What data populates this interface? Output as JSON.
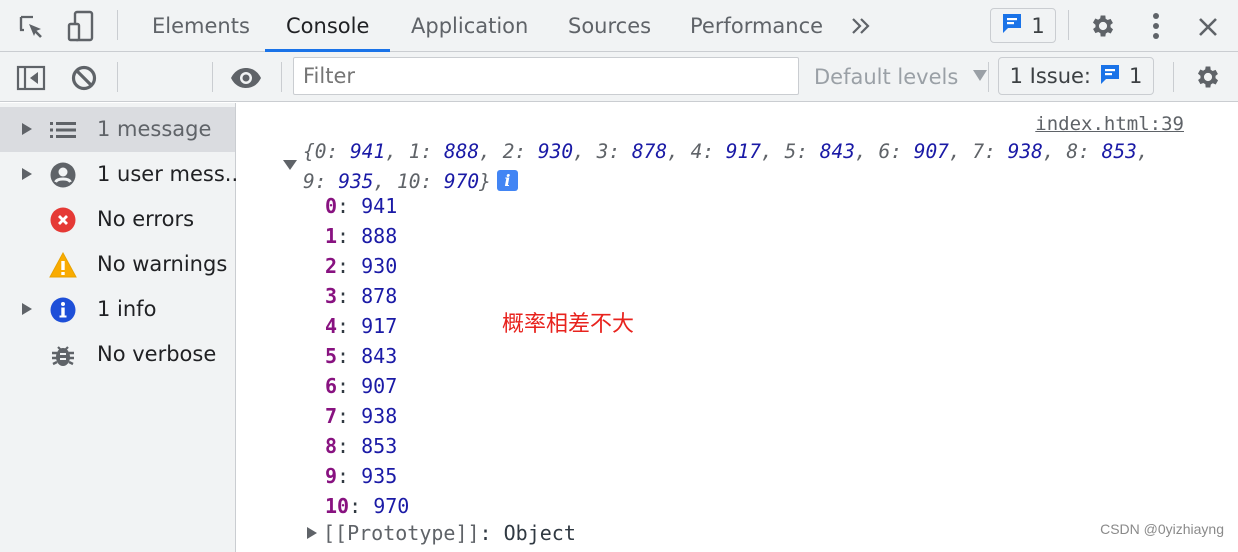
{
  "tabs": [
    {
      "label": "Elements",
      "active": false
    },
    {
      "label": "Console",
      "active": true
    },
    {
      "label": "Application",
      "active": false
    },
    {
      "label": "Sources",
      "active": false
    },
    {
      "label": "Performance",
      "active": false
    }
  ],
  "tabbar": {
    "more_tabs_icon": "chevrons-right-icon",
    "messages_count": "1",
    "accent": "#1a73e8"
  },
  "toolbar": {
    "context": "top",
    "filter_placeholder": "Filter",
    "filter_value": "",
    "levels": "Default levels",
    "issues_label": "1 Issue:",
    "issues_count": "1"
  },
  "sidebar": {
    "items": [
      {
        "label": "1 message",
        "icon": "list-icon",
        "expandable": true,
        "selected": true
      },
      {
        "label": "1 user mess...",
        "icon": "user-icon",
        "expandable": true,
        "selected": false
      },
      {
        "label": "No errors",
        "icon": "error-icon",
        "expandable": false,
        "selected": false
      },
      {
        "label": "No warnings",
        "icon": "warning-icon",
        "expandable": false,
        "selected": false
      },
      {
        "label": "1 info",
        "icon": "info-icon",
        "expandable": true,
        "selected": false
      },
      {
        "label": "No verbose",
        "icon": "bug-icon",
        "expandable": false,
        "selected": false
      }
    ]
  },
  "console": {
    "source_link": "index.html:39",
    "entries": [
      {
        "key": "0",
        "value": "941"
      },
      {
        "key": "1",
        "value": "888"
      },
      {
        "key": "2",
        "value": "930"
      },
      {
        "key": "3",
        "value": "878"
      },
      {
        "key": "4",
        "value": "917"
      },
      {
        "key": "5",
        "value": "843"
      },
      {
        "key": "6",
        "value": "907"
      },
      {
        "key": "7",
        "value": "938"
      },
      {
        "key": "8",
        "value": "853"
      },
      {
        "key": "9",
        "value": "935"
      },
      {
        "key": "10",
        "value": "970"
      }
    ],
    "prototype_label": "[[Prototype]]",
    "prototype_value": "Object",
    "annotation": "概率相差不大"
  },
  "watermark": "CSDN @0yizhiayng"
}
